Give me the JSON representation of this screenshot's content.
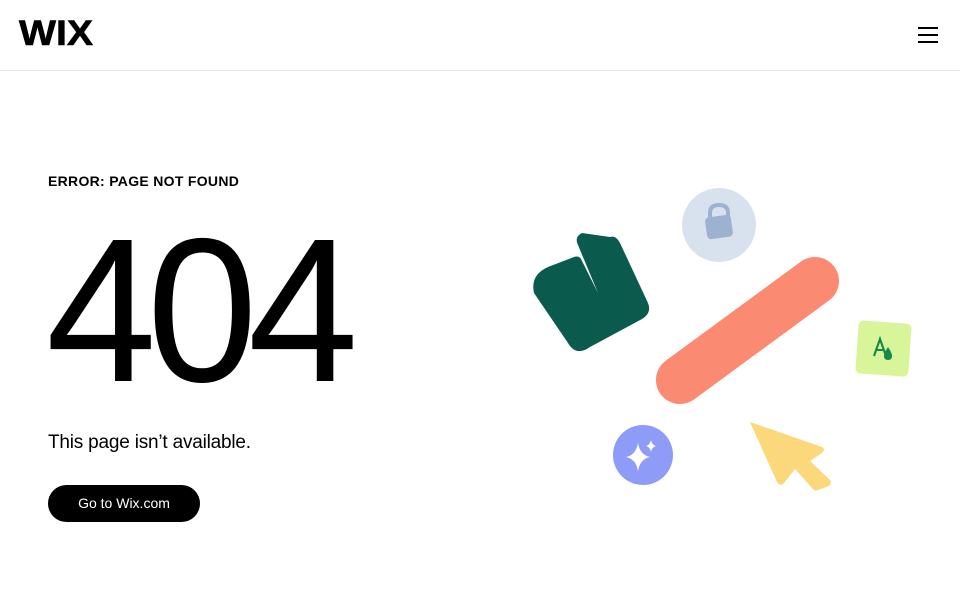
{
  "header": {
    "logo_text": "WIX",
    "menu_icon": "hamburger-menu-icon"
  },
  "error": {
    "label": "ERROR: PAGE NOT FOUND",
    "code": "404",
    "message": "This page isn’t available.",
    "button_label": "Go to Wix.com"
  },
  "illustration": {
    "shapes": [
      {
        "name": "dark-green-block-shape",
        "color": "#0a5a4e"
      },
      {
        "name": "lock-icon",
        "color": "#d8e2ee",
        "icon_color": "#9db2cf"
      },
      {
        "name": "salmon-pill-shape",
        "color": "#fb8a73"
      },
      {
        "name": "text-color-icon",
        "color": "#d8f59a",
        "icon_color": "#168a4a"
      },
      {
        "name": "sparkle-icon",
        "color": "#8f9cf7"
      },
      {
        "name": "cursor-arrow-icon",
        "color": "#fcd87c"
      }
    ]
  }
}
